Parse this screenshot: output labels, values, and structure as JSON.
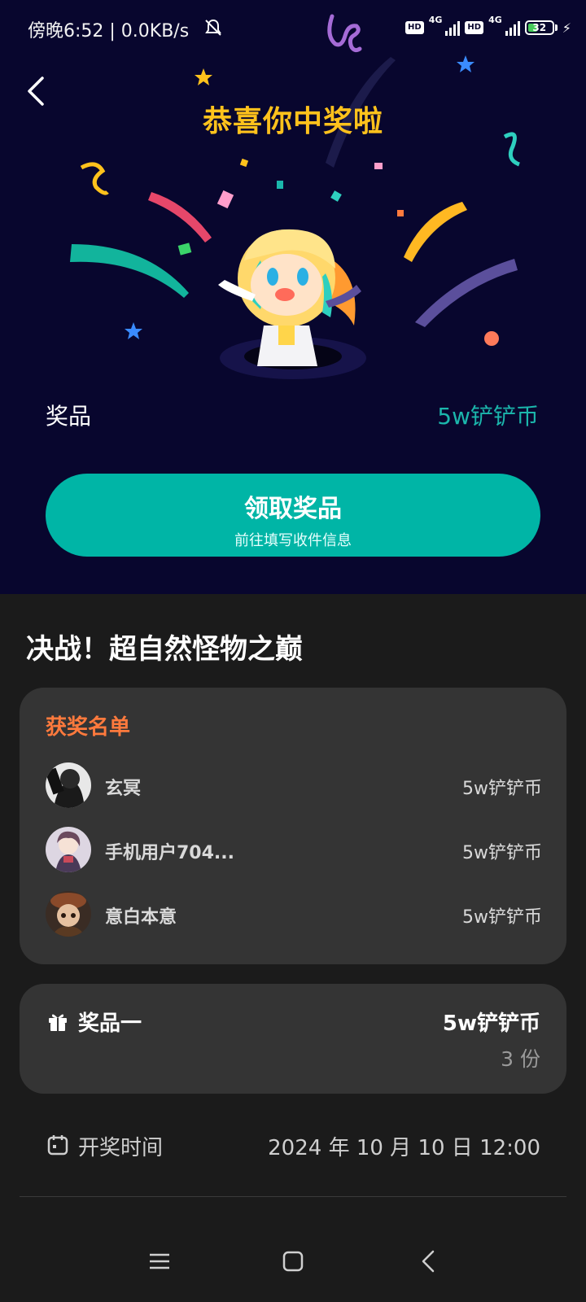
{
  "status_bar": {
    "time": "傍晚6:52 | 0.0KB/s",
    "hd1": "HD",
    "net1": "4G",
    "hd2": "HD",
    "net2": "4G",
    "battery": "32"
  },
  "hero": {
    "title": "恭喜你中奖啦",
    "prize_label": "奖品",
    "prize_value": "5w铲铲币",
    "claim_button": "领取奖品",
    "claim_subtitle": "前往填写收件信息"
  },
  "event": {
    "title": "决战！超自然怪物之巅"
  },
  "winners": {
    "heading": "获奖名单",
    "list": [
      {
        "name": "玄冥",
        "prize": "5w铲铲币"
      },
      {
        "name": "手机用户704...",
        "prize": "5w铲铲币"
      },
      {
        "name": "意白本意",
        "prize": "5w铲铲币"
      }
    ]
  },
  "prize_item": {
    "name": "奖品一",
    "value": "5w铲铲币",
    "quantity": "3 份"
  },
  "draw_time": {
    "label": "开奖时间",
    "value": "2024 年 10 月 10 日 12:00"
  },
  "colors": {
    "hero_bg": "#08062e",
    "title_gold": "#ffc21c",
    "accent_teal": "#00b5a6",
    "heading_orange": "#ff7a3d"
  },
  "icons": [
    "back-icon",
    "gift-icon",
    "calendar-icon",
    "menu-icon",
    "home-icon",
    "nav-back-icon",
    "mute-icon",
    "charging-icon"
  ]
}
